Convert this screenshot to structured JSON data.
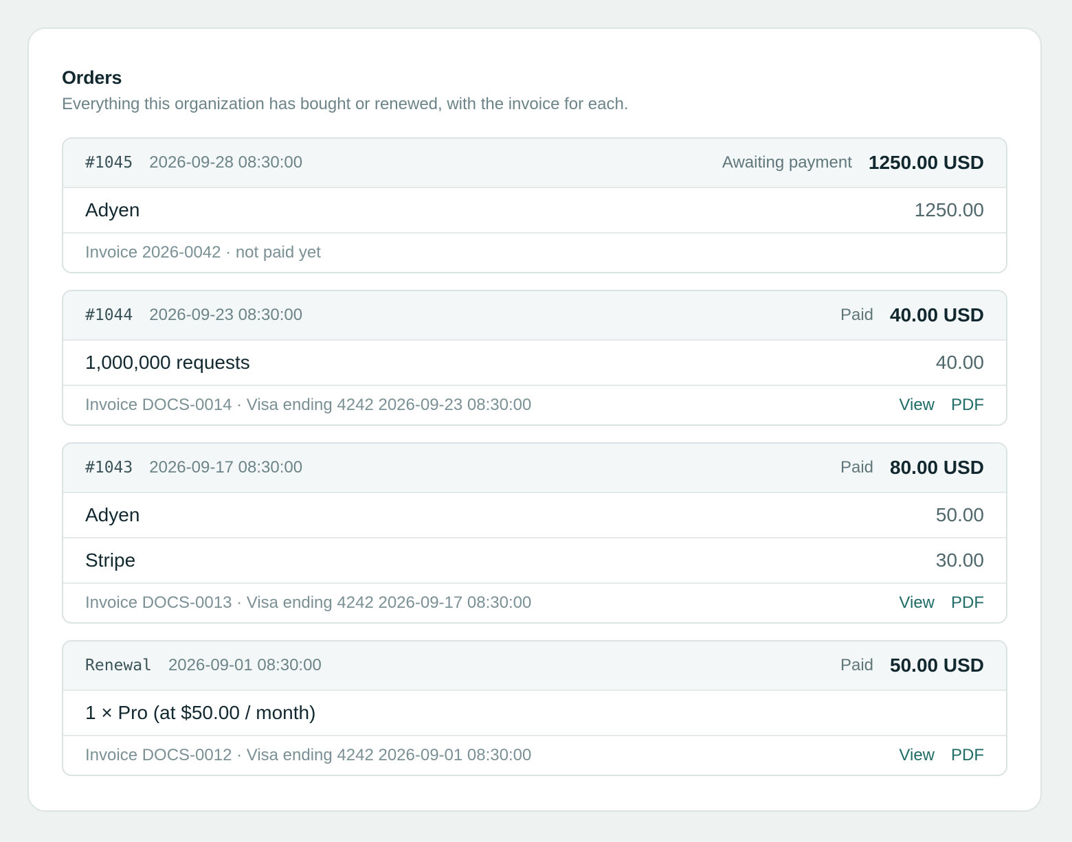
{
  "header": {
    "title": "Orders",
    "subtitle": "Everything this organization has bought or renewed, with the invoice for each."
  },
  "orders": [
    {
      "id": "#1045",
      "date": "2026-09-28 08:30:00",
      "status": "Awaiting payment",
      "total": "1250.00 USD",
      "lines": [
        {
          "name": "Adyen",
          "amount": "1250.00"
        }
      ],
      "invoice_text": "Invoice 2026-0042 · not paid yet",
      "links": []
    },
    {
      "id": "#1044",
      "date": "2026-09-23 08:30:00",
      "status": "Paid",
      "total": "40.00 USD",
      "lines": [
        {
          "name": "1,000,000 requests",
          "amount": "40.00"
        }
      ],
      "invoice_text": "Invoice DOCS-0014 · Visa ending 4242 2026-09-23 08:30:00",
      "links": [
        "View",
        "PDF"
      ]
    },
    {
      "id": "#1043",
      "date": "2026-09-17 08:30:00",
      "status": "Paid",
      "total": "80.00 USD",
      "lines": [
        {
          "name": "Adyen",
          "amount": "50.00"
        },
        {
          "name": "Stripe",
          "amount": "30.00"
        }
      ],
      "invoice_text": "Invoice DOCS-0013 · Visa ending 4242 2026-09-17 08:30:00",
      "links": [
        "View",
        "PDF"
      ]
    },
    {
      "id": "Renewal",
      "date": "2026-09-01 08:30:00",
      "status": "Paid",
      "total": "50.00 USD",
      "lines": [
        {
          "name": "1 × Pro (at $50.00 / month)",
          "amount": ""
        }
      ],
      "invoice_text": "Invoice DOCS-0012 · Visa ending 4242 2026-09-01 08:30:00",
      "links": [
        "View",
        "PDF"
      ]
    }
  ]
}
